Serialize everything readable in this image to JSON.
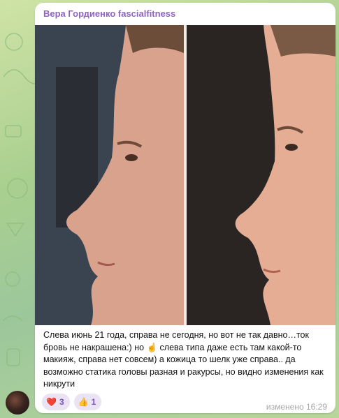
{
  "message": {
    "author": "Вера Гордиенко fascialfitness",
    "text": "Слева июнь 21 года, справа не сегодня, но вот не так давно…ток бровь не накрашена:) но ☝️ слева типа даже есть там какой-то макияж, справа нет совсем) а кожица то шелк уже справа.. да возможно статика головы разная и ракурсы, но видно изменения как никрути",
    "reactions": [
      {
        "icon": "heart-icon",
        "emoji": "❤️",
        "count": "3"
      },
      {
        "icon": "thumbs-up-icon",
        "emoji": "👍",
        "count": "1"
      }
    ],
    "edited_time": "изменено 16:29"
  },
  "colors": {
    "author_name": "#8f63c8",
    "reaction_bg": "#e9e3f3",
    "reaction_text": "#7b52b9",
    "meta_text": "#a7a7a7",
    "chat_background": "#a9cf8f"
  }
}
